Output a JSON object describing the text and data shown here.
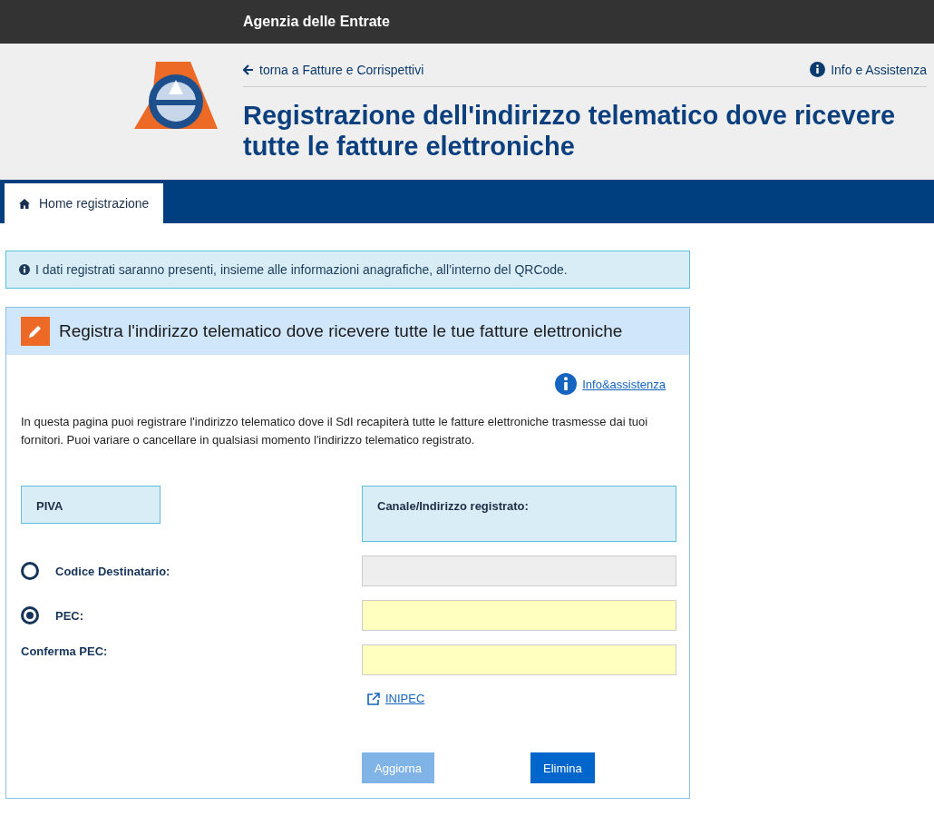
{
  "brand": "Agenzia delle Entrate",
  "back_link": "torna a Fatture e Corrispettivi",
  "help_link": "Info e Assistenza",
  "title": "Registrazione dell'indirizzo telematico dove ricevere tutte le fatture elettroniche",
  "tabs": [
    {
      "label": "Home registrazione",
      "selected": true
    }
  ],
  "notice": "I dati registrati saranno presenti, insieme alle informazioni anagrafiche, all’interno del QRCode.",
  "panel": {
    "title": "Registra l'indirizzo telematico dove ricevere tutte le tue fatture elettroniche",
    "info_link": "Info&assistenza",
    "description": "In questa pagina puoi registrare l'indirizzo telematico dove il SdI recapiterà tutte le fatture elettroniche trasmesse dai tuoi fornitori. Puoi variare o cancellare in qualsiasi momento l'indirizzo telematico registrato.",
    "piva_label": "PIVA",
    "channel_label": "Canale/Indirizzo registrato:",
    "options": [
      {
        "label": "Codice Destinatario:",
        "kind": "radio",
        "selected": false,
        "disabled": true
      },
      {
        "label": "PEC:",
        "kind": "radio",
        "selected": true,
        "disabled": false
      },
      {
        "label": "Conferma PEC:",
        "kind": "plain",
        "disabled": false
      }
    ],
    "inipec_link": "INIPEC",
    "buttons": [
      {
        "label": "Aggiorna",
        "disabled": true
      },
      {
        "label": "Elimina",
        "disabled": false
      }
    ]
  }
}
